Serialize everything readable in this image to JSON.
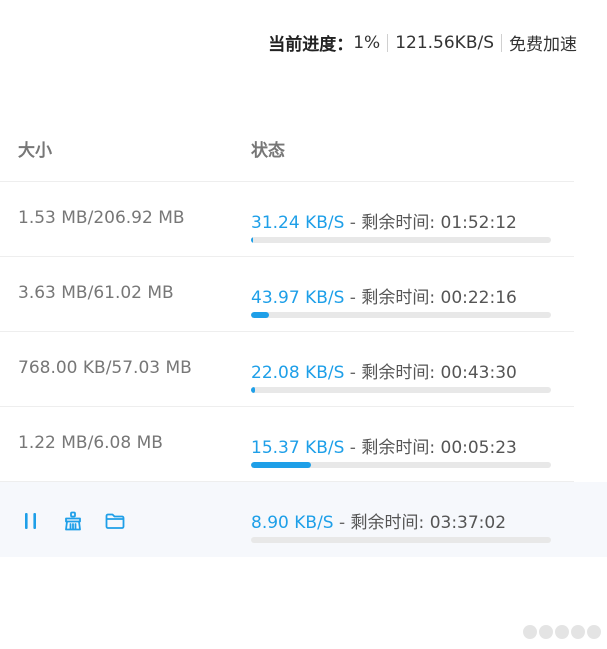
{
  "topbar": {
    "progress_label": "当前进度：",
    "progress_value": "1%",
    "speed": "121.56KB/S",
    "free_speedup": "免费加速"
  },
  "table": {
    "columns": {
      "size": "大小",
      "status": "状态"
    },
    "remaining_label": "剩余时间: ",
    "rows": [
      {
        "size": "1.53 MB/206.92 MB",
        "speed": "31.24 KB/S",
        "remaining": "01:52:12",
        "progress": 0.0074
      },
      {
        "size": "3.63 MB/61.02 MB",
        "speed": "43.97 KB/S",
        "remaining": "00:22:16",
        "progress": 0.0595
      },
      {
        "size": "768.00 KB/57.03 MB",
        "speed": "22.08 KB/S",
        "remaining": "00:43:30",
        "progress": 0.0132
      },
      {
        "size": "1.22 MB/6.08 MB",
        "speed": "15.37 KB/S",
        "remaining": "00:05:23",
        "progress": 0.2007
      },
      {
        "size": "",
        "speed": "8.90 KB/S",
        "remaining": "03:37:02",
        "progress": 0.0
      }
    ]
  },
  "row_actions": {
    "icons": [
      "pause-icon",
      "clean-icon",
      "folder-icon"
    ]
  },
  "colors": {
    "accent": "#1e9fe8",
    "track": "#e8e8e8",
    "active_row_bg": "#f6f8fc"
  }
}
